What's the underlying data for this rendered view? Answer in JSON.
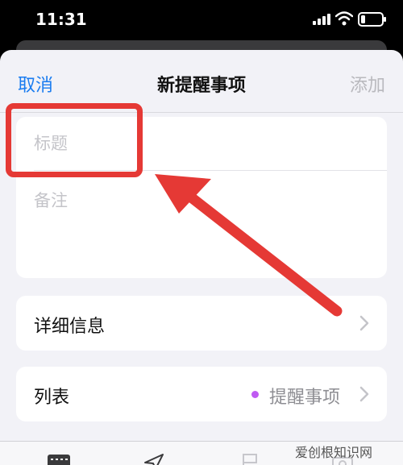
{
  "status_bar": {
    "time": "11:31"
  },
  "nav": {
    "cancel": "取消",
    "title": "新提醒事项",
    "add": "添加"
  },
  "form": {
    "title_placeholder": "标题",
    "notes_placeholder": "备注"
  },
  "details": {
    "label": "详细信息"
  },
  "list": {
    "label": "列表",
    "value": "提醒事项",
    "dot_color": "#bf5af2"
  },
  "icons": {
    "signal": "cellular-signal-icon",
    "wifi": "wifi-icon",
    "battery": "battery-icon",
    "chevron": "chevron-right-icon",
    "toolbar": [
      "calendar-icon",
      "location-icon",
      "flag-icon",
      "camera-icon"
    ]
  },
  "colors": {
    "accent": "#1a7cf0",
    "annotation": "#e53935",
    "background": "#f2f2f7"
  },
  "watermark": "爱创根知识网"
}
